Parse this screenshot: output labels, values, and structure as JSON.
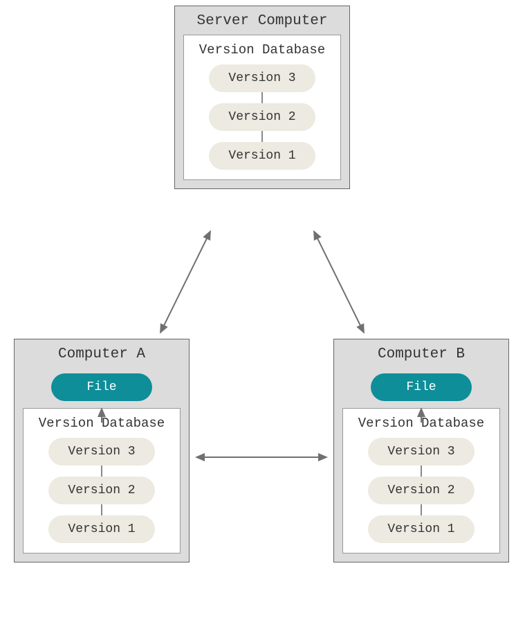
{
  "server": {
    "title": "Server Computer",
    "db_title": "Version Database",
    "versions": {
      "v3": "Version 3",
      "v2": "Version 2",
      "v1": "Version 1"
    }
  },
  "computerA": {
    "title": "Computer A",
    "file_label": "File",
    "db_title": "Version Database",
    "versions": {
      "v3": "Version 3",
      "v2": "Version 2",
      "v1": "Version 1"
    }
  },
  "computerB": {
    "title": "Computer B",
    "file_label": "File",
    "db_title": "Version Database",
    "versions": {
      "v3": "Version 3",
      "v2": "Version 2",
      "v1": "Version 1"
    }
  },
  "colors": {
    "box_bg": "#dcdcdc",
    "pill_bg": "#eceae1",
    "teal": "#0e8e99"
  }
}
